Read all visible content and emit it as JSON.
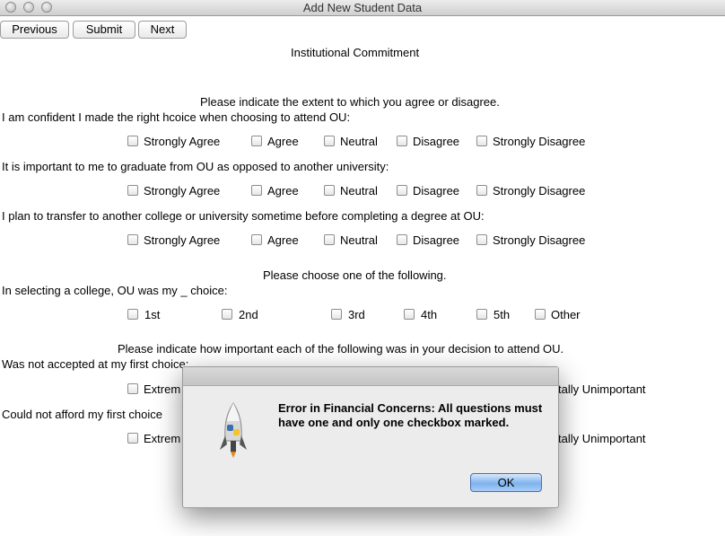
{
  "window": {
    "title": "Add New Student Data"
  },
  "toolbar": {
    "previous_label": "Previous",
    "submit_label": "Submit",
    "next_label": "Next"
  },
  "form": {
    "section_title": "Institutional Commitment",
    "agree_instruction": "Please indicate the extent to which you agree or disagree.",
    "agree_options": [
      "Strongly Agree",
      "Agree",
      "Neutral",
      "Disagree",
      "Strongly Disagree"
    ],
    "agree_questions": [
      "I am confident I made the right hcoice when choosing to attend OU:",
      "It is important to me to graduate from OU as opposed to another university:",
      "I plan to transfer to another college or university sometime before completing a degree at OU:"
    ],
    "choice_instruction": "Please choose one of the following.",
    "choice_question": "In selecting a college, OU was my _ choice:",
    "choice_options": [
      "1st",
      "2nd",
      "3rd",
      "4th",
      "5th",
      "Other"
    ],
    "importance_instruction": "Please indicate how important each of the following was in your decision to attend OU.",
    "importance_questions": [
      "Was not accepted at my first choice:",
      "Could not afford my first choice"
    ],
    "importance_visible_first": "Extrem",
    "importance_visible_last": "tally Unimportant"
  },
  "dialog": {
    "message": "Error in Financial Concerns: All questions must have one and only one checkbox marked.",
    "ok_label": "OK",
    "icon": "python-rocket-icon"
  }
}
